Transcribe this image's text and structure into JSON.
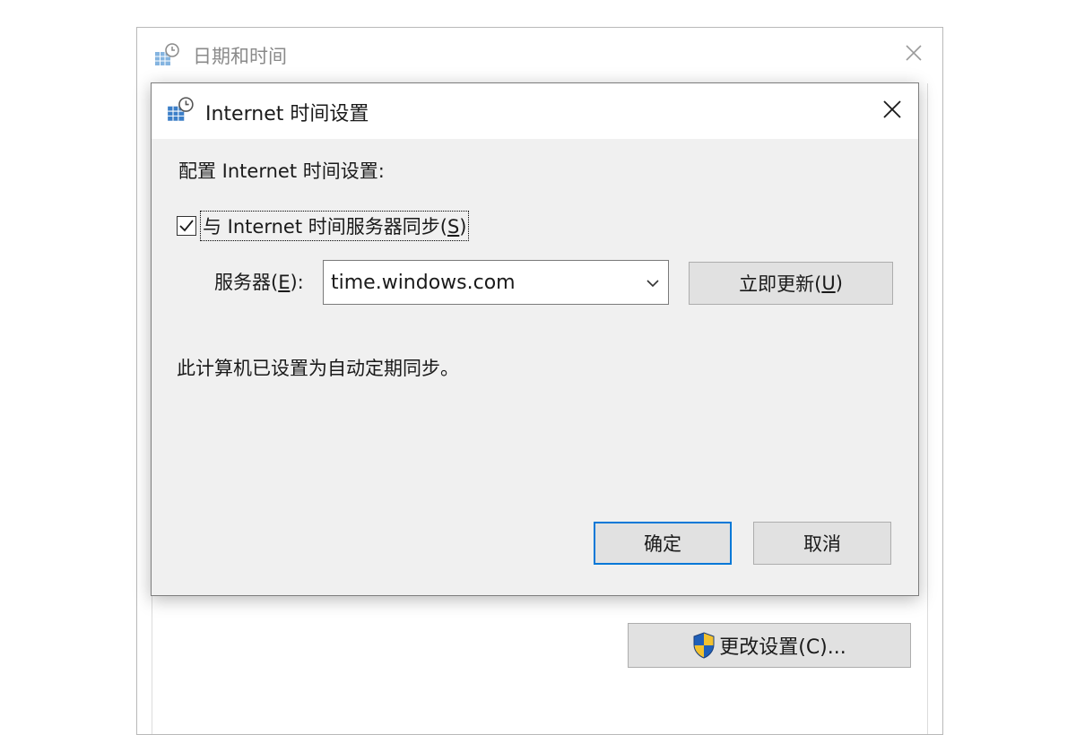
{
  "back_window": {
    "title": "日期和时间",
    "change_settings_label": "更改设置(C)..."
  },
  "dialog": {
    "title": "Internet 时间设置",
    "config_label": "配置 Internet 时间设置:",
    "sync_checkbox": {
      "checked": true,
      "label_pre": "与 Internet 时间服务器同步(",
      "mnemonic": "S",
      "label_post": ")"
    },
    "server": {
      "label_pre": "服务器(",
      "mnemonic": "E",
      "label_post": "):",
      "value": "time.windows.com"
    },
    "update_now": {
      "label_pre": "立即更新(",
      "mnemonic": "U",
      "label_post": ")"
    },
    "status_text": "此计算机已设置为自动定期同步。",
    "ok_label": "确定",
    "cancel_label": "取消"
  },
  "icons": {
    "window_icon": "datetime-network-icon",
    "close_icon": "close-icon",
    "dropdown_icon": "chevron-down-icon",
    "shield_icon": "uac-shield-icon",
    "check_icon": "checkmark-icon"
  },
  "colors": {
    "dialog_background": "#f0f0f0",
    "button_face": "#e1e1e1",
    "focus_accent": "#0078d7"
  }
}
